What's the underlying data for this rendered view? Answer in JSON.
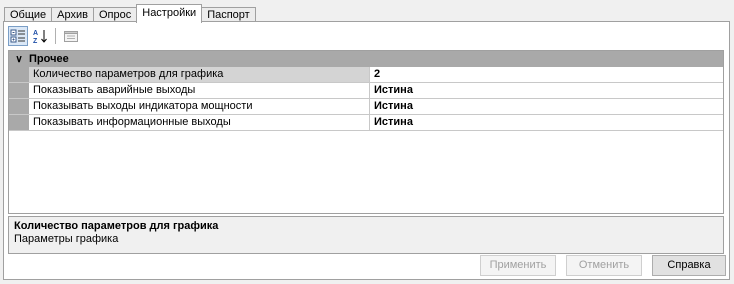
{
  "tabs": [
    {
      "label": "Общие"
    },
    {
      "label": "Архив"
    },
    {
      "label": "Опрос"
    },
    {
      "label": "Настройки"
    },
    {
      "label": "Паспорт"
    }
  ],
  "active_tab": "Настройки",
  "toolbar": {
    "categorized_icon": "categorized-view-icon",
    "alphabetical_icon": "alphabetical-sort-icon",
    "property_pages_icon": "property-pages-icon"
  },
  "grid": {
    "category": "Прочее",
    "rows": [
      {
        "name": "Количество параметров для графика",
        "value": "2"
      },
      {
        "name": "Показывать аварийные выходы",
        "value": "Истина"
      },
      {
        "name": "Показывать выходы индикатора мощности",
        "value": "Истина"
      },
      {
        "name": "Показывать информационные выходы",
        "value": "Истина"
      }
    ]
  },
  "description": {
    "title": "Количество параметров для графика",
    "text": "Параметры графика"
  },
  "buttons": {
    "apply": "Применить",
    "cancel": "Отменить",
    "help": "Справка"
  },
  "colors": {
    "category_bg": "#a9a9a9",
    "selected_row_bg": "#d4d4d4"
  }
}
